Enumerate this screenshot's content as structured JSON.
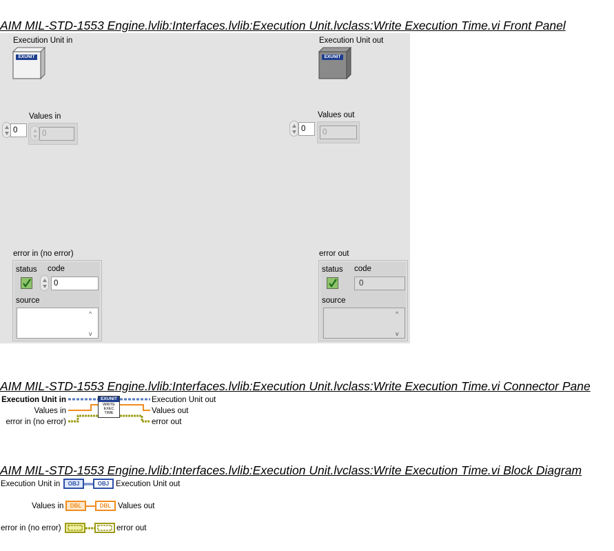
{
  "front_panel": {
    "title": "AIM MIL-STD-1553 Engine.lvlib:Interfaces.lvlib:Execution Unit.lvclass:Write Execution Time.vi Front Panel",
    "exec_in_label": "Execution Unit in",
    "exec_out_label": "Execution Unit out",
    "cube_text": "EXUNIT",
    "values_in_label": "Values in",
    "values_in_index": "0",
    "values_in_value": "0",
    "values_out_label": "Values out",
    "values_out_index": "0",
    "values_out_value": "0",
    "error_in": {
      "label": "error in (no error)",
      "status_label": "status",
      "code_label": "code",
      "code_value": "0",
      "source_label": "source"
    },
    "error_out": {
      "label": "error out",
      "status_label": "status",
      "code_label": "code",
      "code_value": "0",
      "source_label": "source"
    },
    "scroll_up": "^",
    "scroll_down": "v"
  },
  "connector_pane": {
    "title": "AIM MIL-STD-1553 Engine.lvlib:Interfaces.lvlib:Execution Unit.lvclass:Write Execution Time.vi Connector Pane",
    "left_terminals": [
      "Execution Unit in",
      "Values in",
      "error in (no error)"
    ],
    "right_terminals": [
      "Execution Unit out",
      "Values out",
      "error out"
    ],
    "icon_header": "EXUNIT",
    "icon_lines": [
      "WRITE",
      "EXEC",
      "TIME"
    ]
  },
  "block_diagram": {
    "title": "AIM MIL-STD-1553 Engine.lvlib:Interfaces.lvlib:Execution Unit.lvclass:Write Execution Time.vi Block Diagram",
    "rows": [
      {
        "in_label": "Execution Unit in",
        "out_label": "Execution Unit out",
        "in_tag": "OBJ",
        "out_tag": "OBJ"
      },
      {
        "in_label": "Values in",
        "out_label": "Values out",
        "in_tag": "DBL",
        "out_tag": "DBL"
      },
      {
        "in_label": "error in (no error)",
        "out_label": "error out",
        "in_tag": "",
        "out_tag": ""
      }
    ]
  },
  "colors": {
    "panel_bg": "#e3e3e3",
    "class_wire": "#2a4fa8",
    "double_wire": "#f08c1e",
    "error_wire": "#9c9c18",
    "status_led": "#8fc36b"
  }
}
